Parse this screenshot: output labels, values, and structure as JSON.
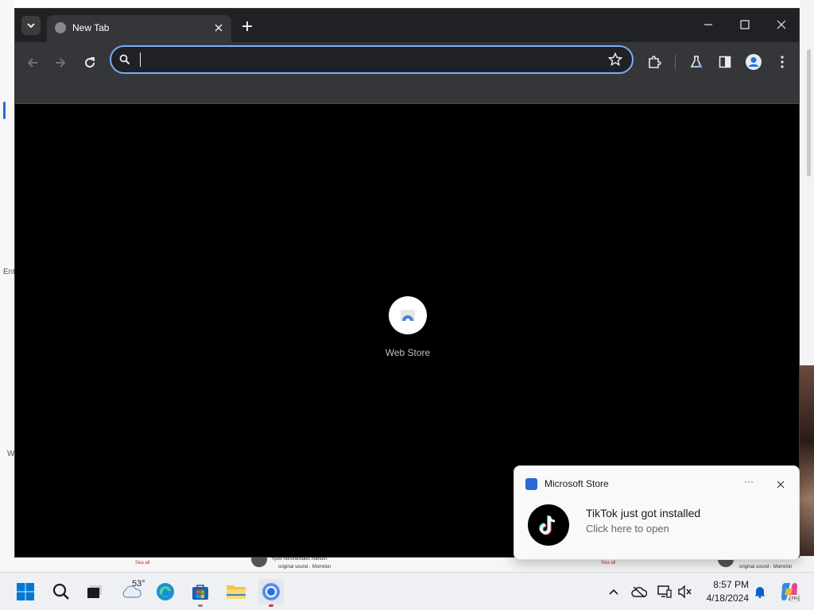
{
  "background_app": {
    "left_text_1": "Ent",
    "left_text_2": "W",
    "bottom_texts": [
      "Sea all",
      "#pov #dronevideo #desert",
      "original sound - Morrelon",
      "Sea all",
      "original sound - Morrelon"
    ]
  },
  "browser": {
    "tab_title": "New Tab",
    "omnibox": {
      "value": "",
      "placeholder": ""
    },
    "shortcuts": [
      {
        "label": "Web Store"
      }
    ],
    "icons": {
      "tab_search": "chevron-down-icon",
      "tab_close": "close-icon",
      "new_tab": "plus-icon",
      "minimize": "minimize-icon",
      "maximize": "maximize-icon",
      "close_window": "close-icon",
      "back": "back-arrow-icon",
      "forward": "forward-arrow-icon",
      "reload": "reload-icon",
      "search": "search-icon",
      "bookmark": "star-icon",
      "extensions": "puzzle-icon",
      "labs": "flask-icon",
      "side_panel": "side-panel-icon",
      "profile": "profile-icon",
      "menu": "kebab-menu-icon"
    }
  },
  "notification": {
    "app_name": "Microsoft Store",
    "more_label": "···",
    "title": "TikTok just got installed",
    "subtitle": "Click here to open"
  },
  "taskbar": {
    "weather_temp": "53°",
    "time": "8:57 PM",
    "date": "4/18/2024",
    "apps": [
      "start",
      "search",
      "task-view",
      "weather",
      "edge",
      "microsoft-store",
      "file-explorer",
      "chrome"
    ],
    "colors": {
      "accent": "#0078d4",
      "chrome_accent": "#7cacf8"
    }
  }
}
